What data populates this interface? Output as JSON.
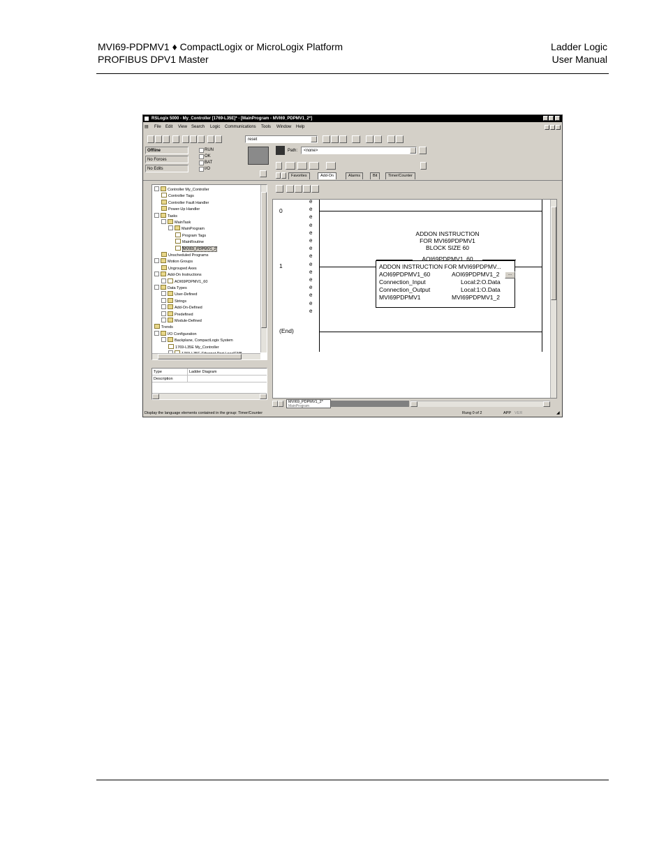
{
  "header": {
    "left_line1": "MVI69-PDPMV1 ♦ CompactLogix or MicroLogix Platform",
    "left_line2": "PROFIBUS DPV1 Master",
    "right_line1": "Ladder Logic",
    "right_line2": "User Manual"
  },
  "app": {
    "title": "RSLogix 5000 - My_Controller [1769-L35E]* - [MainProgram - MVI69_PDPMV1_2*]",
    "menus": [
      "File",
      "Edit",
      "View",
      "Search",
      "Logic",
      "Communications",
      "Tools",
      "Window",
      "Help"
    ],
    "search_value": "reset",
    "status_panel": {
      "mode": "Offline",
      "forces": "No Forces",
      "edits": "No Edits",
      "indicators": [
        "RUN",
        "OK",
        "BAT",
        "I/O"
      ]
    },
    "path_label": "Path:",
    "path_value": "<none>",
    "instruction_tabs": [
      "Favorites",
      "Add-On",
      "Alarms",
      "Bit",
      "Timer/Counter"
    ],
    "active_tab": "Add-On",
    "tree": [
      {
        "label": "Controller My_Controller",
        "level": 0,
        "type": "folder",
        "expander": "−"
      },
      {
        "label": "Controller Tags",
        "level": 1,
        "type": "item"
      },
      {
        "label": "Controller Fault Handler",
        "level": 1,
        "type": "folder"
      },
      {
        "label": "Power-Up Handler",
        "level": 1,
        "type": "folder"
      },
      {
        "label": "Tasks",
        "level": 0,
        "type": "folder",
        "expander": "−"
      },
      {
        "label": "MainTask",
        "level": 1,
        "type": "folder",
        "expander": "−"
      },
      {
        "label": "MainProgram",
        "level": 2,
        "type": "folder",
        "expander": "−"
      },
      {
        "label": "Program Tags",
        "level": 3,
        "type": "item"
      },
      {
        "label": "MainRoutine",
        "level": 3,
        "type": "item"
      },
      {
        "label": "MVI69_PDPMV1_2",
        "level": 3,
        "type": "item",
        "selected": true
      },
      {
        "label": "Unscheduled Programs",
        "level": 1,
        "type": "folder"
      },
      {
        "label": "Motion Groups",
        "level": 0,
        "type": "folder",
        "expander": "−"
      },
      {
        "label": "Ungrouped Axes",
        "level": 1,
        "type": "folder"
      },
      {
        "label": "Add-On Instructions",
        "level": 0,
        "type": "folder",
        "expander": "−"
      },
      {
        "label": "AOI69PDPMV1_60",
        "level": 1,
        "type": "item",
        "expander": "+"
      },
      {
        "label": "Data Types",
        "level": 0,
        "type": "folder",
        "expander": "−"
      },
      {
        "label": "User-Defined",
        "level": 1,
        "type": "folder",
        "expander": "+"
      },
      {
        "label": "Strings",
        "level": 1,
        "type": "folder",
        "expander": "+"
      },
      {
        "label": "Add-On-Defined",
        "level": 1,
        "type": "folder",
        "expander": "+"
      },
      {
        "label": "Predefined",
        "level": 1,
        "type": "folder",
        "expander": "+"
      },
      {
        "label": "Module-Defined",
        "level": 1,
        "type": "folder",
        "expander": "+"
      },
      {
        "label": "Trends",
        "level": 0,
        "type": "folder"
      },
      {
        "label": "I/O Configuration",
        "level": 0,
        "type": "folder",
        "expander": "−"
      },
      {
        "label": "Backplane, CompactLogix System",
        "level": 1,
        "type": "folder",
        "expander": "−"
      },
      {
        "label": "1769-L35E My_Controller",
        "level": 2,
        "type": "item"
      },
      {
        "label": "1769-L35E Ethernet Port LocalENB",
        "level": 2,
        "type": "item",
        "expander": "+"
      }
    ],
    "props": {
      "type_label": "Type",
      "type_value": "Ladder Diagram",
      "desc_label": "Description",
      "desc_value": ""
    },
    "ladder": {
      "rung0_num": "0",
      "rung1_num": "1",
      "end_label": "(End)",
      "comment_lines": [
        "ADDON INSTRUCTION",
        "FOR MVI69PDPMV1",
        "BLOCK SIZE 60"
      ],
      "instr_tag": "AOI69PDPMV1_60",
      "instr_header": "ADDON INSTRUCTION FOR MVI69PDPMV...",
      "params": [
        {
          "name": "AOI69PDPMV1_60",
          "value": "AOI69PDPMV1_2"
        },
        {
          "name": "Connection_Input",
          "value": "Local:2:O.Data"
        },
        {
          "name": "Connection_Output",
          "value": "Local:1:O.Data"
        },
        {
          "name": "MVI69PDPMV1",
          "value": "MVI69PDPMV1_2"
        }
      ],
      "ellipsis_button": "...",
      "marker": "e"
    },
    "routine_tab": "MVI69_PDPMV1_2*",
    "routine_tab_sub": "MainProgram",
    "statusbar": {
      "message": "Display the language elements contained in the group: Timer/Counter",
      "rung": "Rung 0 of 2",
      "app": "APP",
      "ver": "VER"
    }
  }
}
